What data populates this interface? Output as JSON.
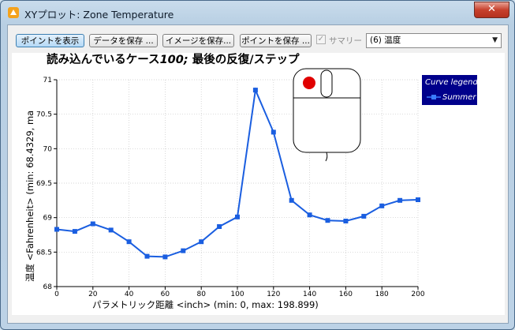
{
  "window": {
    "title": "XYプロット: Zone Temperature",
    "close_label": "✕"
  },
  "toolbar": {
    "show_points_label": "ポイントを表示",
    "save_data_label": "データを保存 ...",
    "save_image_label": "イメージを保存...",
    "save_points_label": "ポイントを保存 ...",
    "summary_label": "サマリー",
    "summary_checked": true,
    "variable_selected": "(6) 温度"
  },
  "chart_data": {
    "type": "line",
    "title": "読み込んでいるケース100; 最後の反復/ステップ",
    "title_plain": "読み込んでいるケース",
    "title_emph": "100;",
    "title_rest": " 最後の反復/ステップ",
    "xlabel": "パラメトリック距離   <inch> (min: 0, max: 198.899)",
    "ylabel": "温度 <Fahrenheit> (min: 68.4329, ma",
    "xlim": [
      0,
      200
    ],
    "ylim": [
      68,
      71
    ],
    "x_ticks": [
      "0",
      "20",
      "40",
      "60",
      "80",
      "100",
      "120",
      "140",
      "160",
      "180",
      "200"
    ],
    "y_ticks": [
      "68",
      "68.5",
      "69",
      "69.5",
      "70",
      "70.5",
      "71"
    ],
    "grid": true,
    "legend": {
      "title": "Curve legend",
      "position": "top-right"
    },
    "series": [
      {
        "name": "Summer",
        "color": "#1a5ee0",
        "x": [
          0,
          10,
          20,
          30,
          40,
          50,
          60,
          70,
          80,
          90,
          100,
          110,
          120,
          130,
          140,
          150,
          160,
          170,
          180,
          190,
          200
        ],
        "y": [
          68.83,
          68.8,
          68.91,
          68.82,
          68.65,
          68.44,
          68.43,
          68.52,
          68.65,
          68.87,
          69.01,
          70.85,
          70.24,
          69.25,
          69.04,
          68.96,
          68.95,
          69.02,
          69.17,
          69.25,
          69.26
        ]
      }
    ]
  },
  "overlay": {
    "icon": "mouse-icon"
  },
  "colors": {
    "line": "#1a5ee0",
    "legend_bg": "#00008b",
    "mouse_button": "#e00000"
  }
}
